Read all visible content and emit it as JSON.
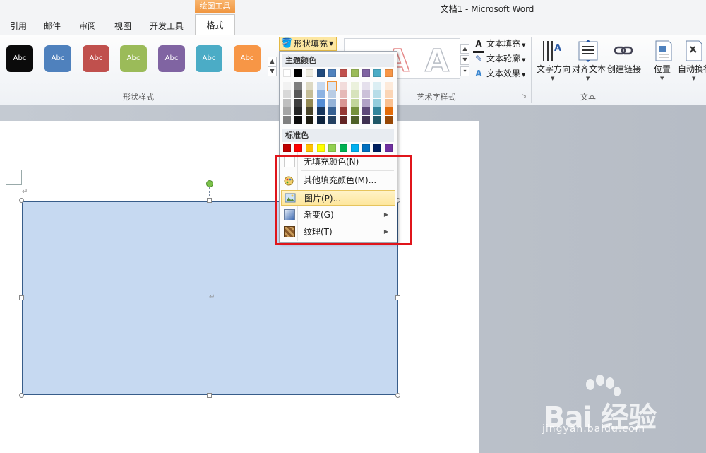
{
  "window": {
    "title": "文档1  -  Microsoft Word"
  },
  "tabs": [
    {
      "label": "引用"
    },
    {
      "label": "邮件"
    },
    {
      "label": "审阅"
    },
    {
      "label": "视图"
    },
    {
      "label": "开发工具"
    }
  ],
  "context_tab": {
    "group": "绘图工具",
    "label": "格式"
  },
  "ribbon": {
    "shape_styles": {
      "group_label": "形状样式",
      "buttons": [
        {
          "label": "Abc",
          "color": "#0b0b0b"
        },
        {
          "label": "Abc",
          "color": "#4f81bd"
        },
        {
          "label": "Abc",
          "color": "#c0504d"
        },
        {
          "label": "Abc",
          "color": "#9bbb59"
        },
        {
          "label": "Abc",
          "color": "#8064a2"
        },
        {
          "label": "Abc",
          "color": "#4bacc6"
        },
        {
          "label": "Abc",
          "color": "#f79646"
        }
      ],
      "fill_button": "形状填充",
      "scroll_icons": [
        "scroll-up-icon",
        "scroll-down-icon",
        "more-icon"
      ]
    },
    "wordart": {
      "group_label": "艺术字样式",
      "text_fill": "文本填充",
      "text_outline": "文本轮廓",
      "text_effects": "文本效果"
    },
    "text_group": {
      "group_label": "文本",
      "direction": "文字方向",
      "align": "对齐文本",
      "link": "创建链接"
    },
    "arrange": {
      "position": "位置",
      "wrap": "自动换行"
    }
  },
  "fill_menu": {
    "theme_header": "主题颜色",
    "theme_top": [
      "#ffffff",
      "#000000",
      "#eeece1",
      "#1f497d",
      "#4f81bd",
      "#c0504d",
      "#9bbb59",
      "#8064a2",
      "#4bacc6",
      "#f79646"
    ],
    "theme_shades": [
      [
        "#f2f2f2",
        "#7f7f7f",
        "#ddd9c3",
        "#c6d9f0",
        "#dbe5f1",
        "#f2dcdb",
        "#ebf1dd",
        "#e5e0ec",
        "#dbeef3",
        "#fdeada"
      ],
      [
        "#d8d8d8",
        "#595959",
        "#c4bd97",
        "#8db3e2",
        "#b8cce4",
        "#e5b9b7",
        "#d7e3bc",
        "#ccc1d9",
        "#b7dde8",
        "#fbd5b5"
      ],
      [
        "#bfbfbf",
        "#3f3f3f",
        "#938953",
        "#548dd4",
        "#95b3d7",
        "#d99694",
        "#c3d69b",
        "#b2a2c7",
        "#92cddc",
        "#fac08f"
      ],
      [
        "#a5a5a5",
        "#262626",
        "#494429",
        "#17365d",
        "#366092",
        "#953734",
        "#76923c",
        "#5f497a",
        "#31859b",
        "#e36c09"
      ],
      [
        "#7f7f7f",
        "#0c0c0c",
        "#1d1b10",
        "#0f243e",
        "#244061",
        "#632423",
        "#4f6128",
        "#3f3151",
        "#205867",
        "#974806"
      ]
    ],
    "standard_header": "标准色",
    "standard": [
      "#c00000",
      "#ff0000",
      "#ffc000",
      "#ffff00",
      "#92d050",
      "#00b050",
      "#00b0f0",
      "#0070c0",
      "#002060",
      "#7030a0"
    ],
    "items": [
      {
        "label": "无填充颜色(N)",
        "icon": "no-fill-icon"
      },
      {
        "label": "其他填充颜色(M)...",
        "icon": "palette-icon"
      },
      {
        "label": "图片(P)...",
        "icon": "picture-icon",
        "highlighted": true
      },
      {
        "label": "渐变(G)",
        "icon": "gradient-icon",
        "submenu": true
      },
      {
        "label": "纹理(T)",
        "icon": "texture-icon",
        "submenu": true
      }
    ]
  },
  "watermark": {
    "brand": "Bai 经验",
    "url": "jingyan.baidu.com"
  }
}
